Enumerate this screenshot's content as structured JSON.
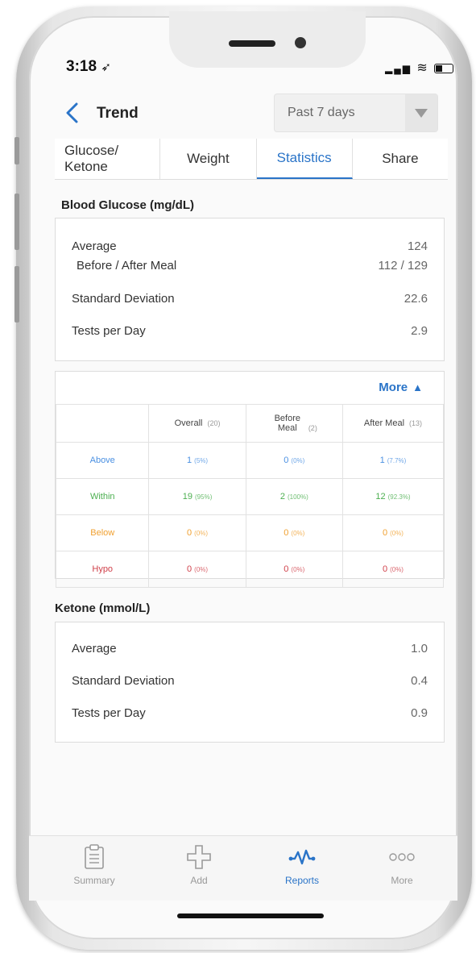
{
  "status_bar": {
    "time": "3:18",
    "signal": "▂▄▆",
    "wifi": "≋"
  },
  "header": {
    "back_icon": "chevron-left-icon",
    "title": "Trend",
    "period": "Past 7 days"
  },
  "tabs": [
    {
      "label_line1": "Glucose/",
      "label_line2": "Ketone",
      "active": false
    },
    {
      "label": "Weight",
      "active": false
    },
    {
      "label": "Statistics",
      "active": true
    },
    {
      "label": "Share",
      "active": false
    }
  ],
  "blood_glucose": {
    "title": "Blood Glucose (mg/dL)",
    "average_label": "Average",
    "average_value": "124",
    "before_after_label": "Before / After Meal",
    "before_after_value": "112 / 129",
    "std_label": "Standard Deviation",
    "std_value": "22.6",
    "tests_label": "Tests per Day",
    "tests_value": "2.9"
  },
  "range_table": {
    "more_label": "More",
    "columns": [
      {
        "label": "Overall",
        "count": "(20)"
      },
      {
        "label": "Before Meal",
        "count": "(2)"
      },
      {
        "label": "After Meal",
        "count": "(13)"
      }
    ],
    "rows": [
      {
        "label": "Above",
        "color": "#4a90e2",
        "cells": [
          {
            "n": "1",
            "p": "(5%)"
          },
          {
            "n": "0",
            "p": "(0%)"
          },
          {
            "n": "1",
            "p": "(7.7%)"
          }
        ]
      },
      {
        "label": "Within",
        "color": "#4caf50",
        "cells": [
          {
            "n": "19",
            "p": "(95%)"
          },
          {
            "n": "2",
            "p": "(100%)"
          },
          {
            "n": "12",
            "p": "(92.3%)"
          }
        ]
      },
      {
        "label": "Below",
        "color": "#f0a030",
        "cells": [
          {
            "n": "0",
            "p": "(0%)"
          },
          {
            "n": "0",
            "p": "(0%)"
          },
          {
            "n": "0",
            "p": "(0%)"
          }
        ]
      },
      {
        "label": "Hypo",
        "color": "#d0404a",
        "cells": [
          {
            "n": "0",
            "p": "(0%)"
          },
          {
            "n": "0",
            "p": "(0%)"
          },
          {
            "n": "0",
            "p": "(0%)"
          }
        ]
      }
    ]
  },
  "ketone": {
    "title": "Ketone (mmol/L)",
    "average_label": "Average",
    "average_value": "1.0",
    "std_label": "Standard Deviation",
    "std_value": "0.4",
    "tests_label": "Tests per Day",
    "tests_value": "0.9"
  },
  "tabbar": [
    {
      "label": "Summary",
      "icon": "clipboard-icon",
      "active": false
    },
    {
      "label": "Add",
      "icon": "plus-icon",
      "active": false
    },
    {
      "label": "Reports",
      "icon": "trend-graph-icon",
      "active": true
    },
    {
      "label": "More",
      "icon": "more-dots-icon",
      "active": false
    }
  ],
  "colors": {
    "accent": "#2a74c8"
  }
}
